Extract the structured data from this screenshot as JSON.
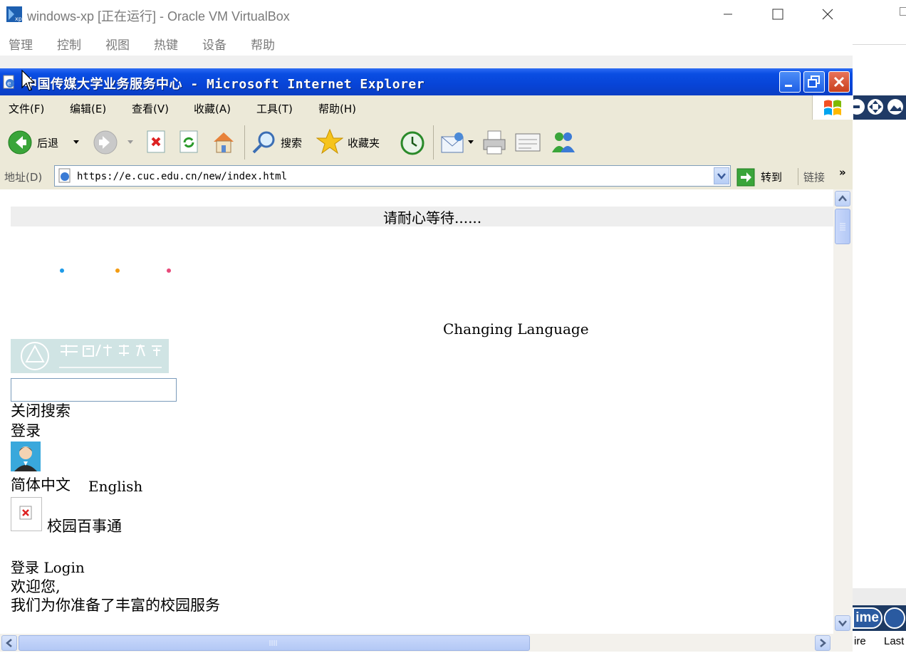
{
  "host_window": {
    "title": "windows-xp [正在运行] - Oracle VM VirtualBox",
    "menu": [
      "管理",
      "控制",
      "视图",
      "热键",
      "设备",
      "帮助"
    ]
  },
  "background_app": {
    "bottom_button": "ime",
    "bottom_text_1": "ire",
    "bottom_text_2": "Last"
  },
  "ie": {
    "title": "中国传媒大学业务服务中心 - Microsoft Internet Explorer",
    "menu": [
      "文件(F)",
      "编辑(E)",
      "查看(V)",
      "收藏(A)",
      "工具(T)",
      "帮助(H)"
    ],
    "toolbar": {
      "back_label": "后退",
      "search_label": "搜索",
      "favorites_label": "收藏夹"
    },
    "address": {
      "label": "地址(D)",
      "url": "https://e.cuc.edu.cn/new/index.html",
      "go_label": "转到",
      "links_label": "链接"
    }
  },
  "page": {
    "loading_text": "请耐心等待......",
    "changing_language": "Changing Language",
    "search_input_value": "",
    "close_search": "关闭搜索",
    "login_top": "登录",
    "lang_cn": "简体中文",
    "lang_en": "English",
    "campus_app": "校园百事通",
    "login_title": "登录  Login",
    "welcome": "欢迎您,",
    "services": "我们为你准备了丰富的校园服务"
  },
  "colors": {
    "xp_title_blue": "#0a4ee3",
    "xp_chrome": "#ece9d8",
    "loader_dot_1": "#1e9be8",
    "loader_dot_2": "#f39c12",
    "loader_dot_3": "#e84a7a"
  }
}
